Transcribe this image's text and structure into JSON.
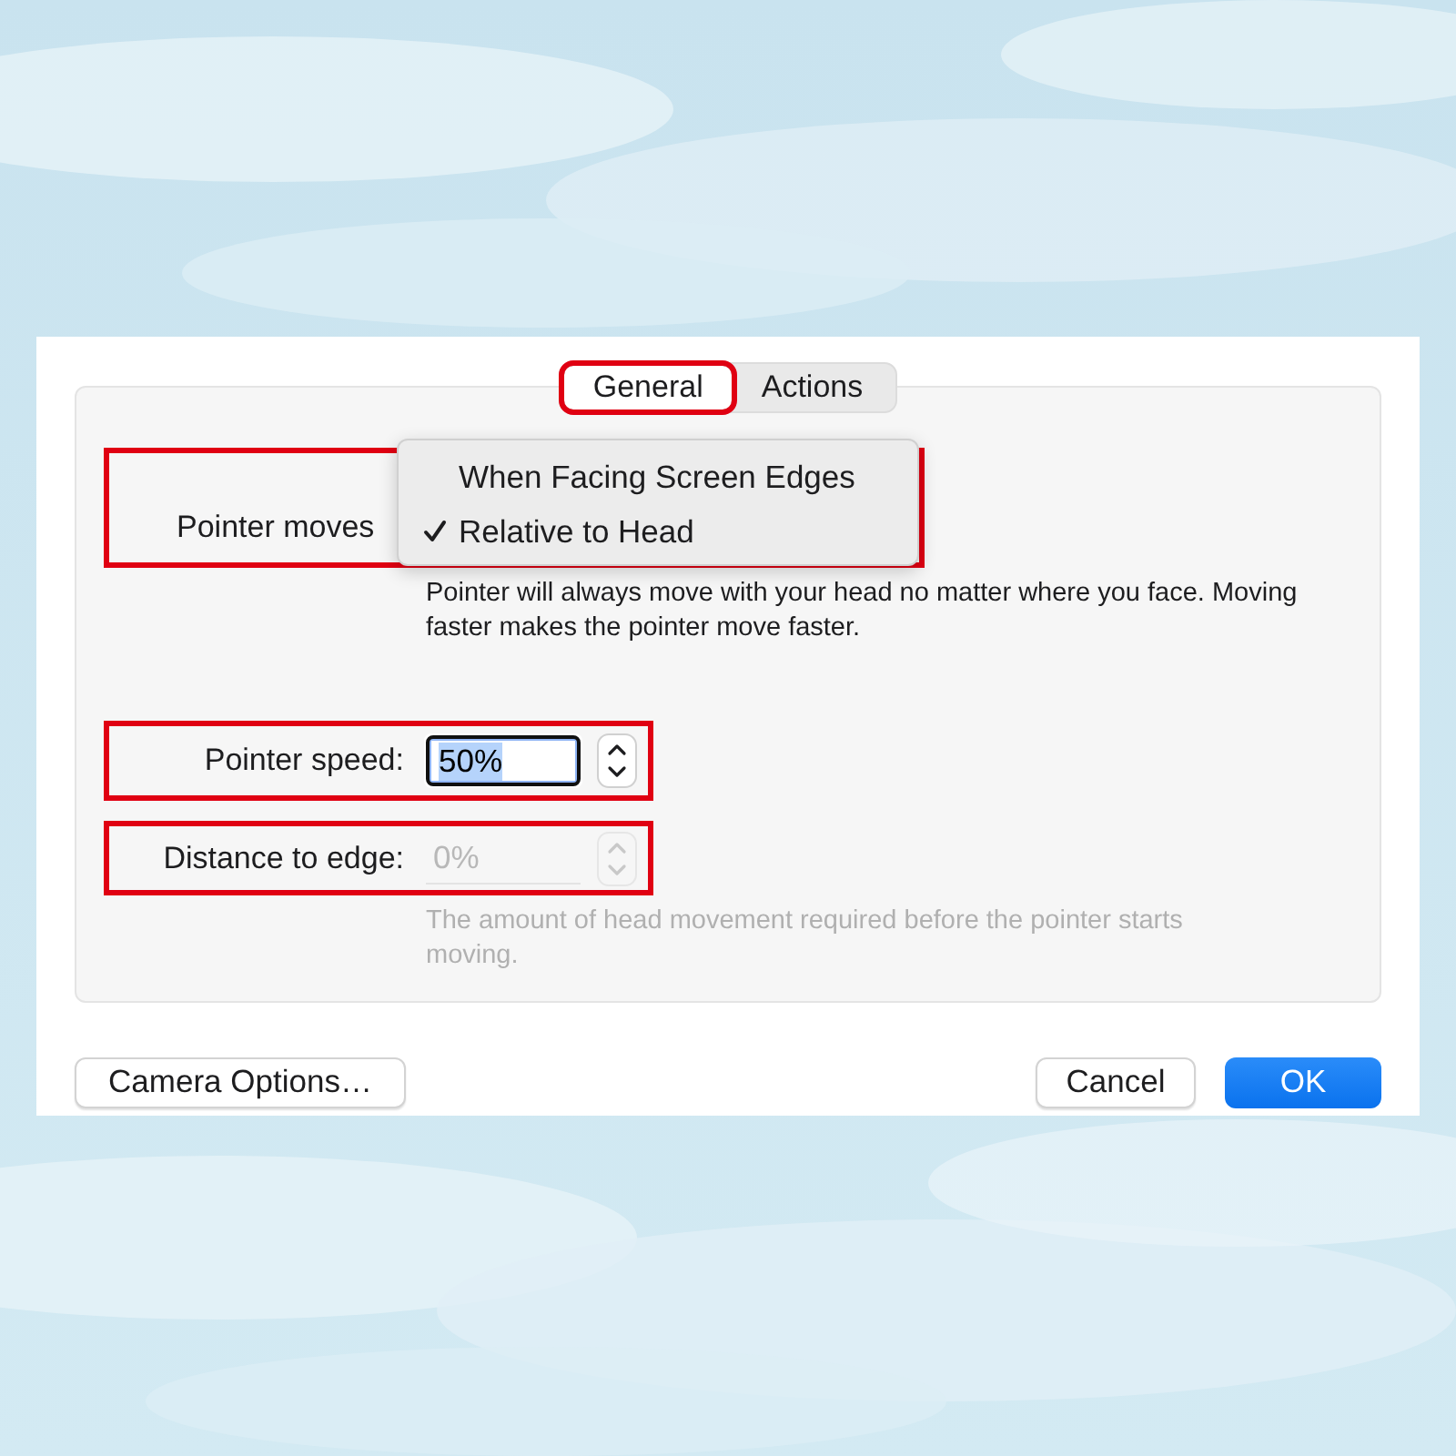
{
  "tabs": [
    {
      "label": "General",
      "selected": true,
      "highlighted": true
    },
    {
      "label": "Actions",
      "selected": false,
      "highlighted": false
    }
  ],
  "pointer_moves": {
    "label": "Pointer moves",
    "highlighted": true,
    "menu": [
      {
        "label": "When Facing Screen Edges",
        "checked": false
      },
      {
        "label": "Relative to Head",
        "checked": true
      }
    ],
    "description": "Pointer will always move with your head no matter where you face. Moving faster makes the pointer move faster."
  },
  "fields": [
    {
      "label": "Pointer speed:",
      "value": "50%",
      "disabled": false,
      "focused": true,
      "highlighted": true
    },
    {
      "label": "Distance to edge:",
      "value": "0%",
      "disabled": true,
      "focused": false,
      "highlighted": true
    }
  ],
  "hint": "The amount of head movement required before the pointer starts moving.",
  "buttons": [
    {
      "label": "Camera Options…",
      "kind": "secondary"
    },
    {
      "label": "Cancel",
      "kind": "secondary"
    },
    {
      "label": "OK",
      "kind": "default"
    }
  ]
}
